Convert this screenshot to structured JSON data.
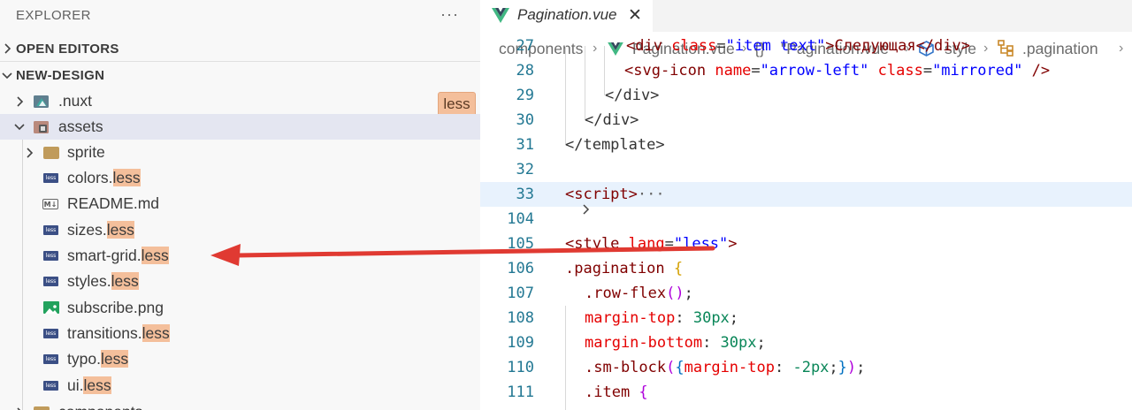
{
  "sidebar": {
    "title": "EXPLORER",
    "more_icon": "···",
    "sections": {
      "open_editors": "OPEN EDITORS",
      "project": "NEW-DESIGN"
    },
    "badge": "less",
    "tree": [
      {
        "name": ".nuxt",
        "hl": ""
      },
      {
        "name": "assets",
        "hl": ""
      },
      {
        "name": "sprite",
        "hl": ""
      },
      {
        "name": "colors.",
        "hl": "less"
      },
      {
        "name": "README.md",
        "hl": ""
      },
      {
        "name": "sizes.",
        "hl": "less"
      },
      {
        "name": "smart-grid.",
        "hl": "less"
      },
      {
        "name": "styles.",
        "hl": "less"
      },
      {
        "name": "subscribe.png",
        "hl": ""
      },
      {
        "name": "transitions.",
        "hl": "less"
      },
      {
        "name": "typo.",
        "hl": "less"
      },
      {
        "name": "ui.",
        "hl": "less"
      },
      {
        "name": "components",
        "hl": ""
      }
    ],
    "less_icon_text": "less",
    "md_icon_text": "M↓"
  },
  "editor": {
    "tab": {
      "title": "Pagination.vue",
      "close": "✕"
    },
    "breadcrumb": {
      "parts": [
        "components",
        "Pagination.vue",
        "{}",
        "\"Pagination.vue\"",
        "style",
        ".pagination"
      ],
      "sep": "›"
    },
    "lines": [
      {
        "n": "27"
      },
      {
        "n": "28"
      },
      {
        "n": "29"
      },
      {
        "n": "30"
      },
      {
        "n": "31"
      },
      {
        "n": "32"
      },
      {
        "n": "33"
      },
      {
        "n": "104"
      },
      {
        "n": "105"
      },
      {
        "n": "106"
      },
      {
        "n": "107"
      },
      {
        "n": "108"
      },
      {
        "n": "109"
      },
      {
        "n": "110"
      },
      {
        "n": "111"
      }
    ],
    "code": {
      "l27_a": "<div ",
      "l27_b": "class",
      "l27_c": "=",
      "l27_d": "\"item text\"",
      "l27_e": ">Следующая</div>",
      "l28_a": "<svg-icon ",
      "l28_b": "name",
      "l28_c": "=",
      "l28_d": "\"arrow-left\"",
      "l28_e": " class",
      "l28_f": "=",
      "l28_g": "\"mirrored\"",
      "l28_h": " />",
      "l29": "</div>",
      "l30": "</div>",
      "l31": "</template>",
      "l33_a": "<script>",
      "l33_b": "···",
      "l105_a": "<style ",
      "l105_b": "lang",
      "l105_c": "=",
      "l105_d": "\"less\"",
      "l105_e": ">",
      "l106_a": ".pagination ",
      "l106_b": "{",
      "l107_a": ".row-flex",
      "l107_b": "()",
      "l107_c": ";",
      "l108_a": "margin-top",
      "l108_b": ": ",
      "l108_c": "30px",
      "l108_d": ";",
      "l109_a": "margin-bottom",
      "l109_b": ": ",
      "l109_c": "30px",
      "l109_d": ";",
      "l110_a": ".sm-block",
      "l110_b": "(",
      "l110_c": "{",
      "l110_d": "margin-top",
      "l110_e": ": ",
      "l110_f": "-2px",
      "l110_g": ";",
      "l110_h": "}",
      "l110_i": ")",
      "l110_j": ";",
      "l111_a": ".item ",
      "l111_b": "{"
    },
    "fold_icon": "›"
  },
  "colors": {
    "highlight": "#f4bf9b",
    "arrow": "#e03a32",
    "line_number": "#237893"
  }
}
